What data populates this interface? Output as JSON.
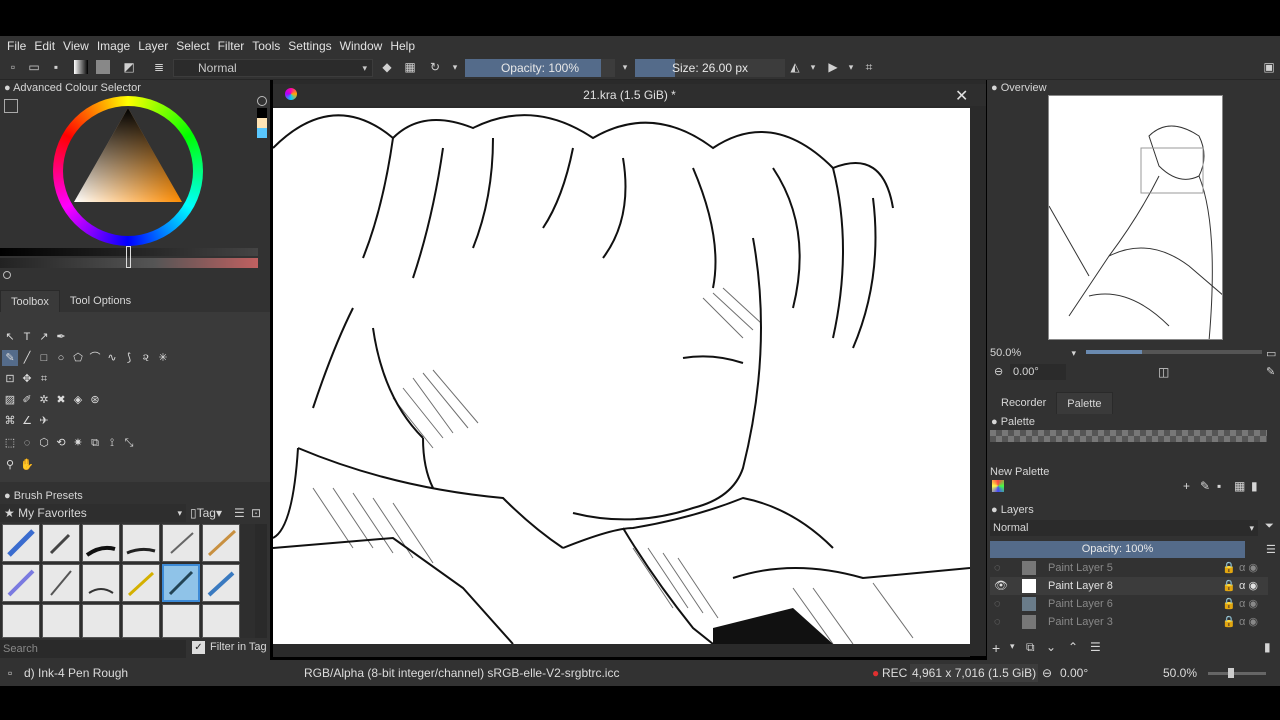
{
  "menu": [
    "File",
    "Edit",
    "View",
    "Image",
    "Layer",
    "Select",
    "Filter",
    "Tools",
    "Settings",
    "Window",
    "Help"
  ],
  "toolbar": {
    "blend_mode": "Normal",
    "opacity": "Opacity: 100%",
    "size": "Size: 26.00 px"
  },
  "color_selector": {
    "title": "Advanced Colour Selector"
  },
  "toolbox_tabs": {
    "toolbox": "Toolbox",
    "tool_options": "Tool Options"
  },
  "brush_presets": {
    "title": "Brush Presets",
    "favorites": "My Favorites",
    "tag": "Tag",
    "search_placeholder": "Search",
    "filter_in_tag": "Filter in Tag"
  },
  "document": {
    "title": "21.kra (1.5 GiB) *"
  },
  "overview": {
    "title": "Overview",
    "zoom": "50.0%",
    "rotation": "0.00°"
  },
  "side_tabs": {
    "recorder": "Recorder",
    "palette": "Palette"
  },
  "palette": {
    "title": "Palette",
    "new_palette": "New Palette"
  },
  "layers": {
    "title": "Layers",
    "blend_mode": "Normal",
    "opacity": "Opacity:  100%",
    "items": [
      {
        "name": "Paint Layer 5",
        "active": false
      },
      {
        "name": "Paint Layer 8",
        "active": true
      },
      {
        "name": "Paint Layer 6",
        "active": false
      },
      {
        "name": "Paint Layer 3",
        "active": false
      }
    ]
  },
  "status": {
    "brush": "d) Ink-4 Pen Rough",
    "color_model": "RGB/Alpha (8-bit integer/channel)  sRGB-elle-V2-srgbtrc.icc",
    "rec": "REC",
    "dimensions": "4,961 x 7,016 (1.5 GiB)",
    "rotation": "0.00°",
    "zoom": "50.0%"
  },
  "colors": {
    "accent": "#546b8a",
    "panel": "#323232",
    "rec": "#e03030"
  }
}
